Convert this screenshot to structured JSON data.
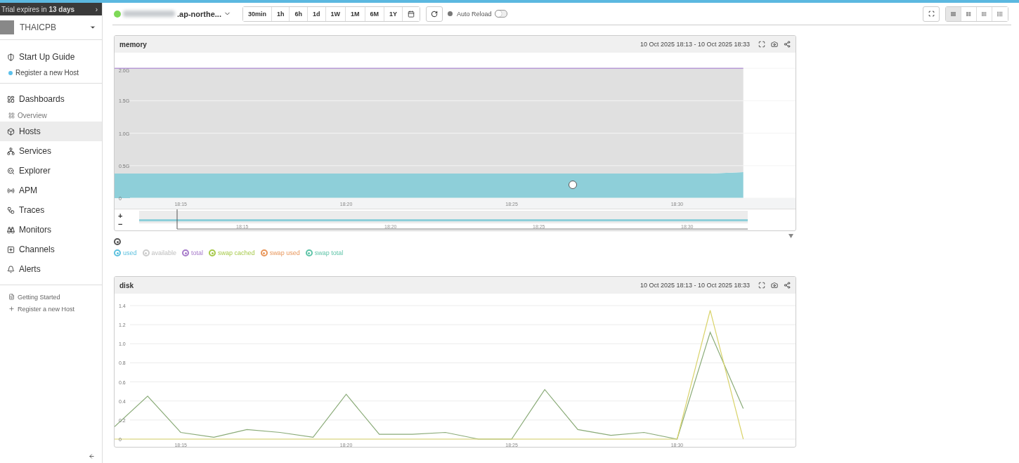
{
  "sidebar": {
    "trial_banner": "Trial expires in **13 days**",
    "banner_arrow": "›",
    "organization": "THAICPB",
    "guide": {
      "title": "Start Up Guide",
      "steps": [
        {
          "label": "Register a new Host",
          "color": "#5bc0eb"
        }
      ]
    },
    "nav": [
      {
        "kind": "main",
        "label": "Dashboards",
        "selected": false
      },
      {
        "kind": "sub",
        "label": "Overview",
        "selected": false
      },
      {
        "kind": "main",
        "label": "Hosts",
        "selected": true
      },
      {
        "kind": "main",
        "label": "Services",
        "selected": false
      },
      {
        "kind": "main",
        "label": "Explorer",
        "selected": false
      },
      {
        "kind": "main",
        "label": "APM",
        "selected": false
      },
      {
        "kind": "main",
        "label": "Traces",
        "selected": false
      },
      {
        "kind": "main",
        "label": "Monitors",
        "selected": false
      },
      {
        "kind": "main",
        "label": "Channels",
        "selected": false
      },
      {
        "kind": "main",
        "label": "Alerts",
        "selected": false
      }
    ],
    "footer_links": [
      "Getting Started",
      "Register a new Host"
    ]
  },
  "toolbar": {
    "host": {
      "name": ".ap-northe...",
      "color": "#7ed957"
    },
    "ranges": [
      "30min",
      "1h",
      "6h",
      "1d",
      "1W",
      "1M",
      "6M",
      "1Y"
    ],
    "auto_reload": {
      "label": "Auto Reload",
      "on": false
    },
    "layouts": [
      {
        "selected": true
      },
      {
        "selected": false
      },
      {
        "selected": false
      },
      {
        "selected": false
      }
    ]
  },
  "panels": [
    {
      "title": "memory",
      "time_range": "10 Oct 2025 18:13 - 10 Oct 2025 18:33",
      "chart_data": {
        "type": "area",
        "categories": [
          null,
          null,
          "18:15",
          null,
          null,
          null,
          null,
          "18:20",
          null,
          null,
          null,
          null,
          "18:25",
          null,
          null,
          null,
          null,
          "18:30",
          null,
          null
        ],
        "stacked": true,
        "grid": true,
        "ylim": [
          0,
          2.51
        ],
        "yticks": [
          {
            "value": 0,
            "label": "0"
          },
          {
            "value": 0.5,
            "label": "0.5G"
          },
          {
            "value": 1,
            "label": "1.0G"
          },
          {
            "value": 1.5,
            "label": "1.5G"
          },
          {
            "value": 2,
            "label": "2.0G"
          }
        ],
        "series": [
          {
            "color": "#8ecfd9",
            "values": [
              0.38,
              0.38,
              0.38,
              0.38,
              0.38,
              0.38,
              0.38,
              0.38,
              0.38,
              0.38,
              0.38,
              0.38,
              0.38,
              0.38,
              0.38,
              0.38,
              0.38,
              0.38,
              0.38,
              0.4
            ]
          },
          {
            "color": "#e0e0e0",
            "values": [
              1.62,
              1.62,
              1.62,
              1.62,
              1.62,
              1.62,
              1.62,
              1.62,
              1.62,
              1.62,
              1.62,
              1.62,
              1.62,
              1.62,
              1.62,
              1.62,
              1.62,
              1.62,
              1.62,
              1.6
            ]
          }
        ]
      },
      "navigator_ticks": [
        "18:15",
        "18:20",
        "18:25",
        "18:30"
      ],
      "zoom_in": "+",
      "zoom_out": "−",
      "legend": [
        {
          "label": "used",
          "color": "#5bc0de",
          "on": true
        },
        {
          "label": "available",
          "color": "#cccccc",
          "on": false
        },
        {
          "label": "total",
          "color": "#a77bca",
          "on": true
        },
        {
          "label": "swap cached",
          "color": "#a6c94a",
          "on": true
        },
        {
          "label": "swap used",
          "color": "#e8965a",
          "on": true
        },
        {
          "label": "swap total",
          "color": "#5fc4a8",
          "on": true
        }
      ]
    },
    {
      "title": "disk",
      "time_range": "10 Oct 2025 18:13 - 10 Oct 2025 18:33",
      "chart_data": {
        "type": "line",
        "categories": [
          null,
          null,
          "18:15",
          null,
          null,
          null,
          null,
          "18:20",
          null,
          null,
          null,
          null,
          "18:25",
          null,
          null,
          null,
          null,
          "18:30",
          null,
          null
        ],
        "grid": true,
        "ylim": [
          0,
          1.709
        ],
        "yticks": [
          {
            "value": 0,
            "label": "0"
          },
          {
            "value": 0.2,
            "label": "0.2"
          },
          {
            "value": 0.4,
            "label": "0.4"
          },
          {
            "value": 0.6,
            "label": "0.6"
          },
          {
            "value": 0.8,
            "label": "0.8"
          },
          {
            "value": 1,
            "label": "1.0"
          },
          {
            "value": 1.2,
            "label": "1.2"
          },
          {
            "value": 1.4,
            "label": "1.4"
          }
        ],
        "series": [
          {
            "color": "#8aab78",
            "values": [
              0.13,
              0.45,
              0.07,
              0.02,
              0.1,
              0.07,
              0.02,
              0.47,
              0.05,
              0.05,
              0.07,
              0,
              0,
              0.52,
              0.1,
              0.04,
              0.07,
              0,
              1.12,
              0.32
            ]
          },
          {
            "color": "#d9d36a",
            "values": [
              0,
              0,
              0,
              0,
              0,
              0,
              0,
              0,
              0,
              0,
              0,
              0,
              0,
              0,
              0,
              0,
              0,
              0,
              1.35,
              0
            ]
          }
        ]
      }
    }
  ]
}
